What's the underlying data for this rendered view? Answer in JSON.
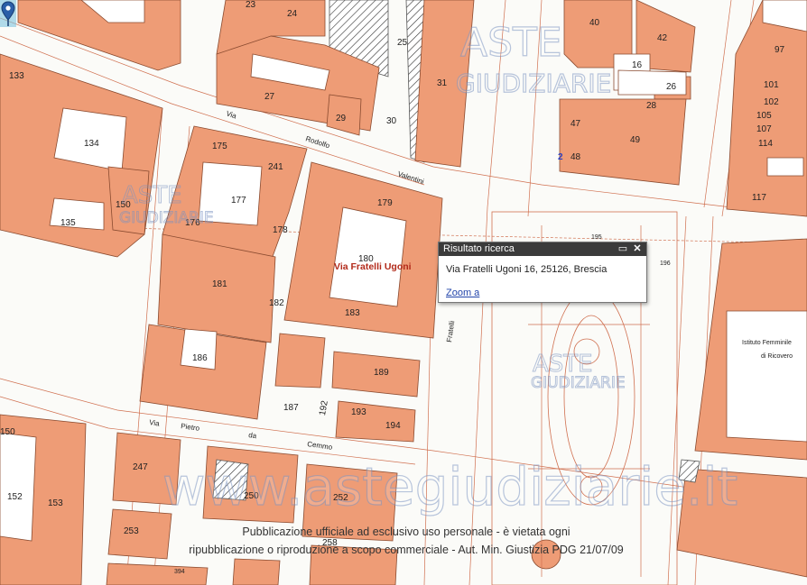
{
  "map": {
    "parcels": [
      "23",
      "24",
      "25",
      "27",
      "29",
      "30",
      "31",
      "40",
      "42",
      "16",
      "26",
      "28",
      "47",
      "49",
      "2",
      "48",
      "97",
      "101",
      "102",
      "105",
      "107",
      "114",
      "117",
      "133",
      "134",
      "135",
      "150",
      "175",
      "241",
      "177",
      "176",
      "178",
      "179",
      "180",
      "181",
      "183",
      "182",
      "186",
      "189",
      "187",
      "192",
      "193",
      "194",
      "150",
      "152",
      "153",
      "247",
      "250",
      "252",
      "253",
      "258",
      "394",
      "195",
      "196"
    ],
    "streets": [
      "Via",
      "Rodolfo",
      "Valentini",
      "Via Fratelli Ugoni",
      "Fratelli",
      "Via",
      "Pietro",
      "da",
      "Cemmo"
    ],
    "landmarks": [
      "Istituto Femminile",
      "di Ricovero"
    ],
    "selected_label": "Via Fratelli Ugoni"
  },
  "watermarks": {
    "logo_top": "ASTE",
    "logo_bottom": "GIUDIZIARIE",
    "site": "www.astegiudiziarie.it"
  },
  "notice": {
    "line1": "Pubblicazione ufficiale ad esclusivo uso personale - è vietata ogni",
    "line2": "ripubblicazione o riproduzione a scopo commerciale - Aut. Min. Giustizia PDG 21/07/09"
  },
  "popup": {
    "title": "Risultato ricerca",
    "max_icon": "maximize-icon",
    "close_icon": "close-icon",
    "address": "Via Fratelli Ugoni 16, 25126, Brescia",
    "zoom_link": "Zoom a"
  }
}
